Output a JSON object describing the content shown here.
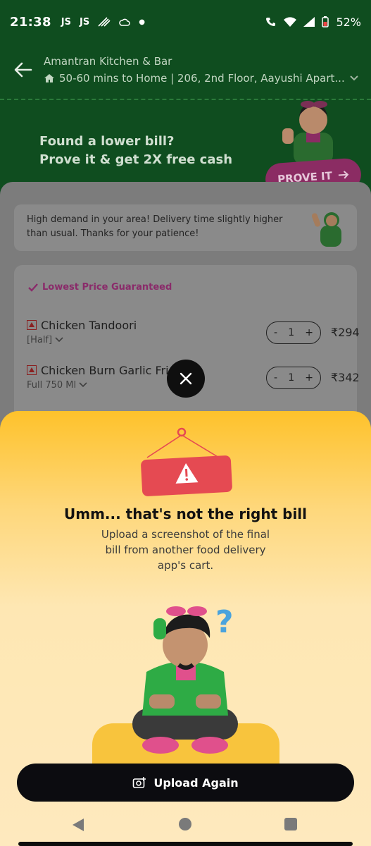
{
  "status_bar": {
    "time": "21:38",
    "left_icons": [
      "Jiosaavn-icon",
      "Jiosaavn-icon",
      "signal-lines-icon",
      "cloud-icon",
      "dot-icon"
    ],
    "right_icons": [
      "wifi-call-icon",
      "wifi-icon",
      "signal-icon",
      "battery-icon"
    ],
    "battery": "52%"
  },
  "header": {
    "restaurant": "Amantran Kitchen & Bar",
    "address": "50-60 mins to Home | 206, 2nd Floor, Aayushi Apart..."
  },
  "banner": {
    "line1": "Found a lower bill?",
    "line2": "Prove it & get 2X free cash",
    "button": "PROVE IT"
  },
  "notice": {
    "text": "High demand in your area! Delivery time slightly higher than usual. Thanks for your patience!"
  },
  "cart": {
    "badge": "Lowest Price Guaranteed",
    "items": [
      {
        "name": "Chicken Tandoori",
        "variant": "[Half]",
        "qty": "1",
        "price": "₹294"
      },
      {
        "name": "Chicken Burn Garlic Frie",
        "variant": "Full 750 Ml",
        "qty": "1",
        "price": "₹342"
      }
    ]
  },
  "sheet": {
    "title": "Umm... that's not the right bill",
    "desc_line1": "Upload a screenshot of the final",
    "desc_line2": "bill from another food delivery",
    "desc_line3": "app's cart.",
    "button": "Upload Again"
  },
  "colors": {
    "brand_green": "#0f4d1f",
    "accent_pink": "#8b2c63",
    "sheet_yellow": "#fec22b",
    "warning_red": "#e54a52",
    "button_dark": "#0c0c10"
  }
}
